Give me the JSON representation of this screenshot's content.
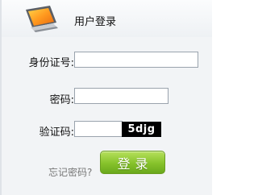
{
  "header": {
    "title": "用户登录",
    "logo_icon": "computer-monitor-icon"
  },
  "form": {
    "id_label": "身份证号:",
    "id_value": "",
    "password_label": "密码:",
    "password_value": "",
    "captcha_label": "验证码:",
    "captcha_value": "",
    "captcha_code": "5djg"
  },
  "actions": {
    "forgot_label": "忘记密码?",
    "login_label": "登录"
  },
  "colors": {
    "login_button": "#86c22b",
    "panel_bg": "#f2f4f6",
    "captcha_bg": "#000000"
  }
}
